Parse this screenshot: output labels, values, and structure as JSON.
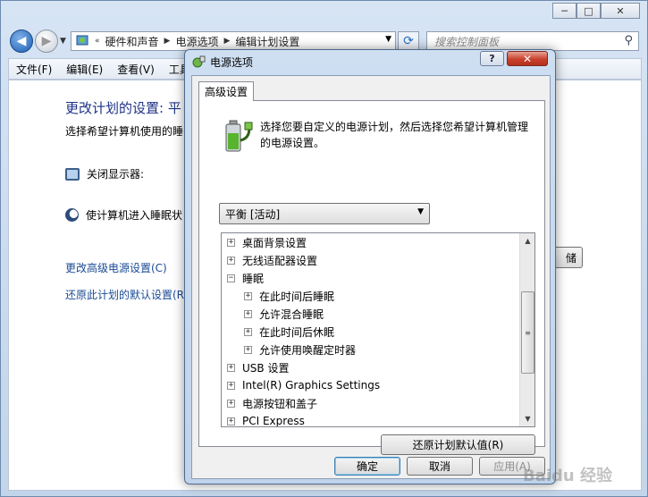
{
  "explorer": {
    "title_buttons": [
      "─",
      "□",
      "✕"
    ],
    "breadcrumb": {
      "lead": "«",
      "items": [
        "硬件和声音",
        "电源选项",
        "编辑计划设置"
      ]
    },
    "search_placeholder": "搜索控制面板",
    "menu": [
      "文件(F)",
      "编辑(E)",
      "查看(V)",
      "工具"
    ],
    "page_title": "更改计划的设置: 平",
    "page_desc": "选择希望计算机使用的睡",
    "display_off_label": "关闭显示器:",
    "sleep_label": "使计算机进入睡眠状",
    "link_advanced": "更改高级电源设置(C)",
    "link_restore": "还原此计划的默认设置(R",
    "bg_button_label": "储"
  },
  "dialog": {
    "title": "电源选项",
    "help_label": "?",
    "close_label": "✕",
    "tab_label": "高级设置",
    "description": "选择您要自定义的电源计划，然后选择您希望计算机管理的电源设置。",
    "plan_selected": "平衡 [活动]",
    "tree": [
      {
        "label": "桌面背景设置",
        "level": 0,
        "expander": "+"
      },
      {
        "label": "无线适配器设置",
        "level": 0,
        "expander": "+"
      },
      {
        "label": "睡眠",
        "level": 0,
        "expander": "−"
      },
      {
        "label": "在此时间后睡眠",
        "level": 1,
        "expander": "+"
      },
      {
        "label": "允许混合睡眠",
        "level": 1,
        "expander": "+"
      },
      {
        "label": "在此时间后休眠",
        "level": 1,
        "expander": "+"
      },
      {
        "label": "允许使用唤醒定时器",
        "level": 1,
        "expander": "+"
      },
      {
        "label": "USB 设置",
        "level": 0,
        "expander": "+"
      },
      {
        "label": "Intel(R) Graphics Settings",
        "level": 0,
        "expander": "+"
      },
      {
        "label": "电源按钮和盖子",
        "level": 0,
        "expander": "+"
      },
      {
        "label": "PCI Express",
        "level": 0,
        "expander": "+"
      }
    ],
    "restore_button": "还原计划默认值(R)",
    "ok_button": "确定",
    "cancel_button": "取消",
    "apply_button": "应用(A)"
  },
  "watermark": "Baidu 经验"
}
